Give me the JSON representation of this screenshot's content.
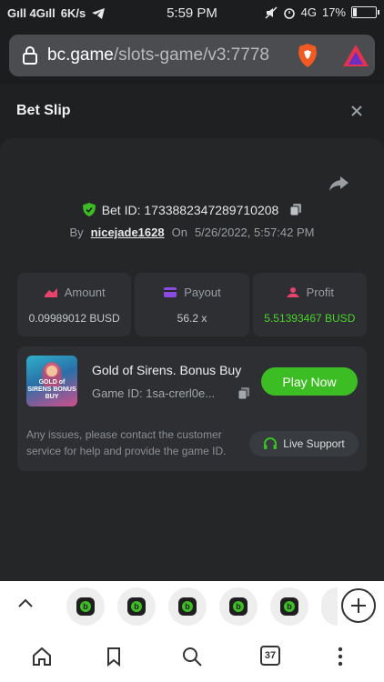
{
  "status_bar": {
    "signal_text": "Gıll 4Gıll",
    "speed": "6K/s",
    "time": "5:59 PM",
    "network": "4G",
    "battery_percent": "17%",
    "battery_level": 0.17
  },
  "browser": {
    "url_domain": "bc.game",
    "url_path": "/slots-game/v3:7778",
    "tabs_count": "37"
  },
  "bet_slip": {
    "title": "Bet Slip",
    "bet_id_label": "Bet ID: 1733882347289710208",
    "by_label": "By",
    "username": "nicejade1628",
    "on_label": "On",
    "datetime": "5/26/2022, 5:57:42 PM",
    "stats": [
      {
        "label": "Amount",
        "value": "0.09989012 BUSD"
      },
      {
        "label": "Payout",
        "value": "56.2 x"
      },
      {
        "label": "Profit",
        "value": "5.51393467 BUSD"
      }
    ],
    "game": {
      "thumb_title": "GOLD of SIRENS BONUS BUY",
      "name": "Gold of Sirens. Bonus Buy",
      "game_id": "Game ID: 1sa-crerl0e...",
      "play_label": "Play Now"
    },
    "issue_text": "Any issues, please contact the customer service for help and provide the game ID.",
    "support_label": "Live Support"
  },
  "colors": {
    "accent_green": "#3dbd24",
    "profit_green": "#4bd32a",
    "amount_icon": "#e8436b",
    "payout_icon": "#8a4ce0",
    "profit_icon": "#e8436b"
  }
}
